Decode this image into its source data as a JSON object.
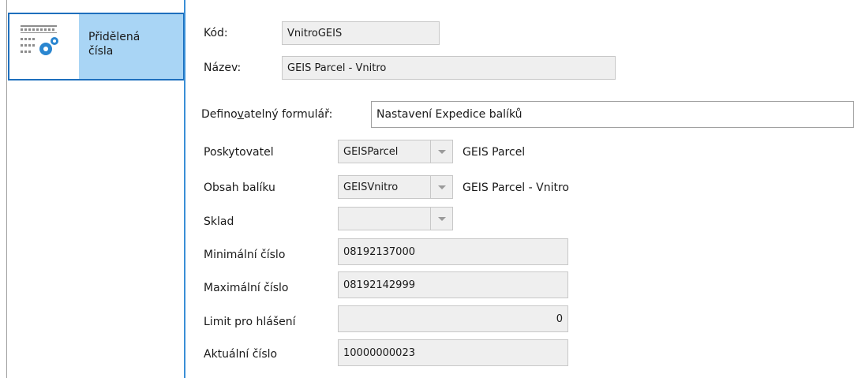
{
  "sidebar": {
    "item": {
      "label_line1": "Přidělená",
      "label_line2": "čísla",
      "icon": "numbers-gear-icon"
    }
  },
  "header": {
    "kod": {
      "label": "Kód:",
      "value": "VnitroGEIS"
    },
    "nazev": {
      "label": "Název:",
      "value": "GEIS Parcel - Vnitro"
    }
  },
  "form": {
    "label_before": "Defino",
    "label_accel": "v",
    "label_after": "atelný formulář:",
    "value": "Nastavení Expedice balíků"
  },
  "fields": {
    "poskytovatel": {
      "label": "Poskytovatel",
      "value": "GEISParcel",
      "desc": "GEIS Parcel"
    },
    "obsah": {
      "label": "Obsah balíku",
      "value": "GEISVnitro",
      "desc": "GEIS Parcel - Vnitro"
    },
    "sklad": {
      "label": "Sklad",
      "value": ""
    },
    "min": {
      "label": "Minimální číslo",
      "value": "08192137000"
    },
    "max": {
      "label": "Maximální číslo",
      "value": "08192142999"
    },
    "limit": {
      "label": "Limit pro hlášení",
      "value": "0"
    },
    "aktualni": {
      "label": "Aktuální číslo",
      "value": "10000000023"
    }
  },
  "colors": {
    "sidebar_selected": "#a9d5f5",
    "sidebar_border": "#1e6fbd",
    "separator": "#3a8fd6",
    "readonly_field": "#efefef"
  }
}
